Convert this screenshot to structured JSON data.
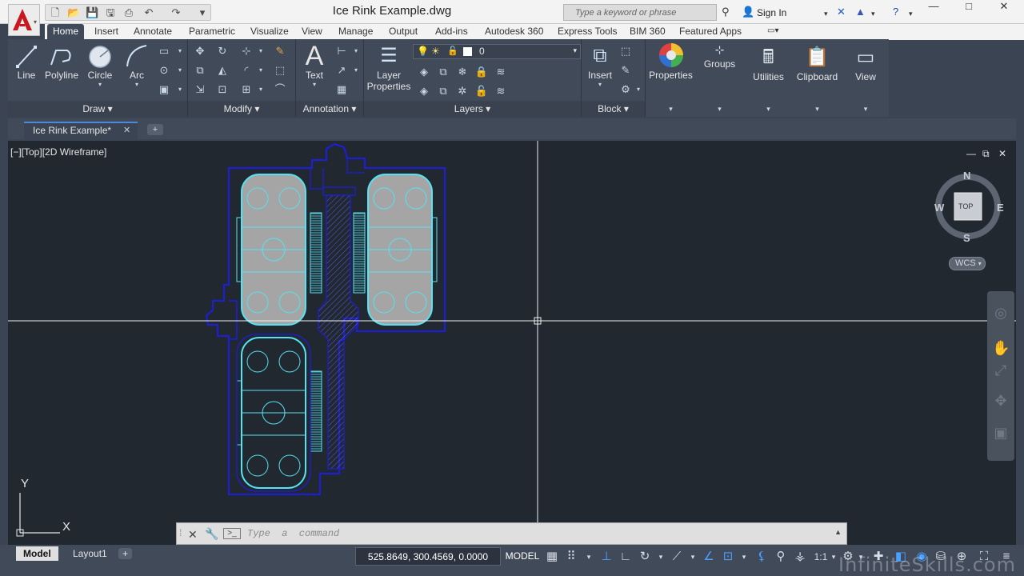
{
  "window": {
    "title": "Ice Rink Example.dwg",
    "search_placeholder": "Type a keyword or phrase",
    "sign_in": "Sign In"
  },
  "ribbon_tabs": [
    "Home",
    "Insert",
    "Annotate",
    "Parametric",
    "Visualize",
    "View",
    "Manage",
    "Output",
    "Add-ins",
    "Autodesk 360",
    "Express Tools",
    "BIM 360",
    "Featured Apps"
  ],
  "active_tab": "Home",
  "draw_panel": {
    "title": "Draw",
    "tools": [
      "Line",
      "Polyline",
      "Circle",
      "Arc"
    ]
  },
  "modify_panel": {
    "title": "Modify"
  },
  "annotation_panel": {
    "title": "Annotation",
    "text_label": "Text"
  },
  "layers_panel": {
    "title": "Layers",
    "layer_properties_label": "Layer\nProperties",
    "current_layer": "0"
  },
  "block_panel": {
    "title": "Block",
    "insert_label": "Insert"
  },
  "extra_panels": [
    "Properties",
    "Groups",
    "Utilities",
    "Clipboard",
    "View"
  ],
  "file_tab": {
    "label": "Ice Rink Example*"
  },
  "viewport": {
    "label": "[−][Top][2D Wireframe]",
    "viewcube": {
      "n": "N",
      "s": "S",
      "e": "E",
      "w": "W",
      "face": "TOP"
    },
    "wcs": "WCS",
    "ucs_x": "X",
    "ucs_y": "Y"
  },
  "command_line": {
    "placeholder": "Type  a  command"
  },
  "status_bar": {
    "layout_tabs": [
      "Model",
      "Layout1"
    ],
    "coordinates": "525.8649, 300.4569, 0.0000",
    "model_label": "MODEL",
    "scale": "1:1"
  },
  "watermark": "InfiniteSkills.com",
  "colors": {
    "canvas": "#212830",
    "rink_outline": "#56e2f2",
    "building_outline": "#1d1de0",
    "rink_fill": "#a5a5a5"
  }
}
